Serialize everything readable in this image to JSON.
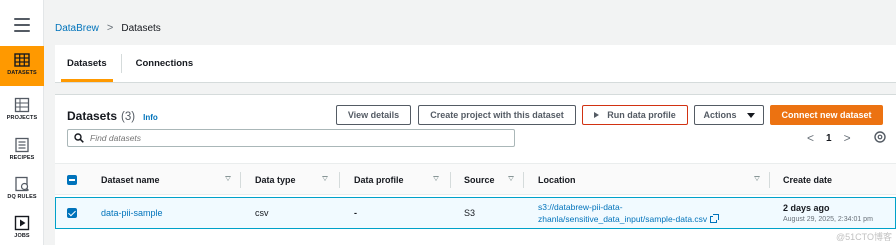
{
  "sidebar": {
    "items": [
      {
        "label": "DATASETS",
        "icon": "grid-icon",
        "active": true
      },
      {
        "label": "PROJECTS",
        "icon": "grid-icon"
      },
      {
        "label": "RECIPES",
        "icon": "list-icon"
      },
      {
        "label": "DQ RULES",
        "icon": "checklist-icon"
      },
      {
        "label": "JOBS",
        "icon": "play-icon"
      }
    ]
  },
  "breadcrumb": {
    "root": "DataBrew",
    "separator": ">",
    "current": "Datasets"
  },
  "tabs": [
    {
      "label": "Datasets",
      "active": true
    },
    {
      "label": "Connections",
      "active": false
    }
  ],
  "card": {
    "title": "Datasets",
    "count": "(3)",
    "info": "Info",
    "buttons": {
      "view_details": "View details",
      "create_project": "Create project with this dataset",
      "run_profile": "Run data profile",
      "actions": "Actions",
      "connect": "Connect new dataset"
    },
    "search": {
      "placeholder": "Find datasets",
      "value": ""
    },
    "pager": {
      "prev": "<",
      "page": "1",
      "next": ">"
    }
  },
  "table": {
    "columns": [
      "Dataset name",
      "Data type",
      "Data profile",
      "Source",
      "Location",
      "Create date"
    ],
    "rows": [
      {
        "selected": true,
        "name": "data-pii-sample",
        "type": "csv",
        "profile": "-",
        "source": "S3",
        "location_line1": "s3://databrew-pii-data-",
        "location_line2": "zhanla/sensitive_data_input/sample-data.csv",
        "date": "2 days ago",
        "date_full": "August 29, 2025, 2:34:01 pm"
      }
    ]
  },
  "watermark": "@51CTO博客",
  "colors": {
    "accent": "#ff9900",
    "primary_button": "#ec7211",
    "link": "#0073bb",
    "highlight_border": "#d13212"
  }
}
